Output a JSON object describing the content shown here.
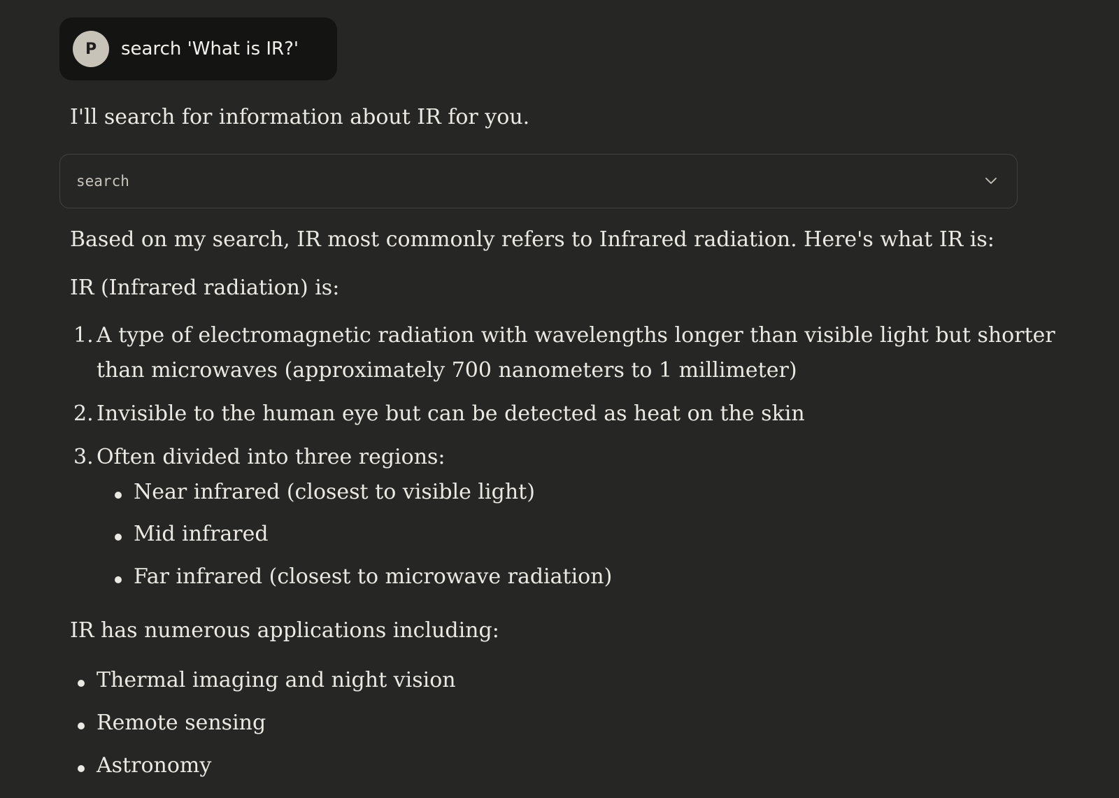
{
  "user_message": {
    "avatar_initial": "P",
    "text": "search 'What is IR?'"
  },
  "assistant": {
    "intro": "I'll search for information about IR for you.",
    "tool_call": {
      "label": "search",
      "icon": "chevron-down-icon"
    },
    "summary": "Based on my search, IR most commonly refers to Infrared radiation. Here's what IR is:",
    "definition_heading": "IR (Infrared radiation) is:",
    "numbered_items": [
      {
        "number": "1.",
        "lines": [
          "A type of electromagnetic radiation with wavelengths longer than visible light but shorter",
          "than microwaves (approximately 700 nanometers to 1 millimeter)"
        ]
      },
      {
        "number": "2.",
        "lines": [
          "Invisible to the human eye but can be detected as heat on the skin"
        ]
      },
      {
        "number": "3.",
        "lines": [
          "Often divided into three regions:"
        ],
        "sub_items": [
          "Near infrared (closest to visible light)",
          "Mid infrared",
          "Far infrared (closest to microwave radiation)"
        ]
      }
    ],
    "applications_heading": "IR has numerous applications including:",
    "applications": [
      "Thermal imaging and night vision",
      "Remote sensing",
      "Astronomy"
    ]
  }
}
